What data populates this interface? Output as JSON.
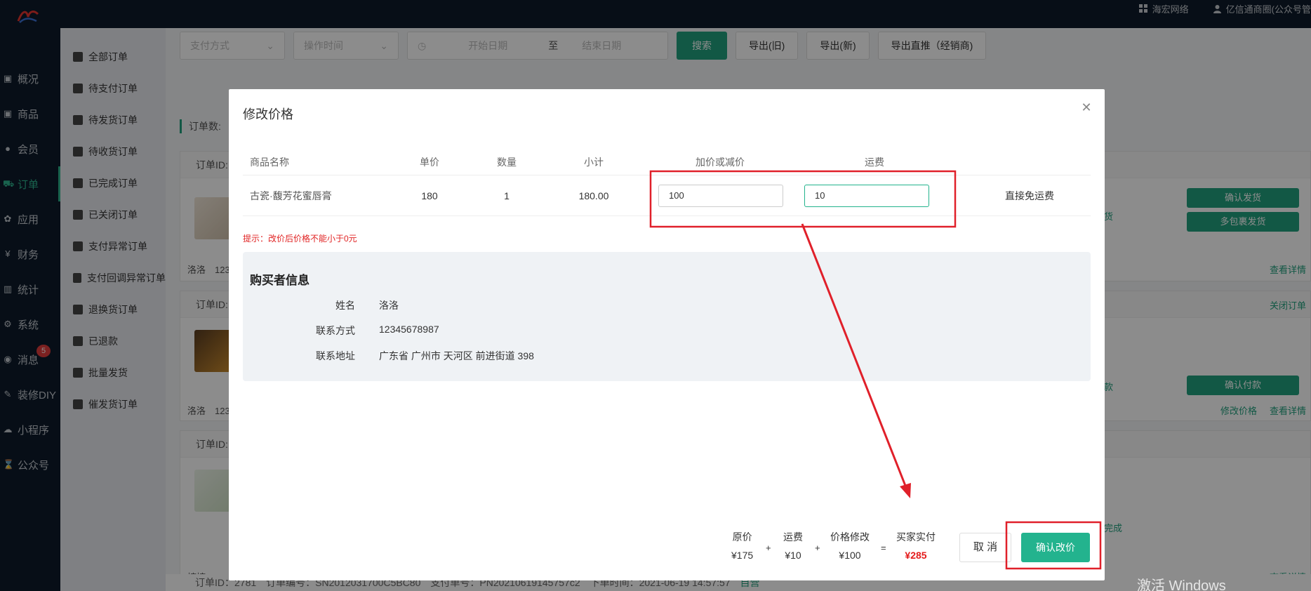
{
  "topbar": {
    "network_label": "海宏网络",
    "account_label": "亿信通商圈(公众号管"
  },
  "sidebar": {
    "items": [
      {
        "label": "概况",
        "icon": "dashboard-icon"
      },
      {
        "label": "商品",
        "icon": "goods-icon"
      },
      {
        "label": "会员",
        "icon": "members-icon"
      },
      {
        "label": "订单",
        "icon": "cart-icon",
        "active": true
      },
      {
        "label": "应用",
        "icon": "apps-icon"
      },
      {
        "label": "财务",
        "icon": "yen-icon"
      },
      {
        "label": "统计",
        "icon": "chart-icon"
      },
      {
        "label": "系统",
        "icon": "gear-icon"
      },
      {
        "label": "消息",
        "icon": "message-icon",
        "badge": "5"
      },
      {
        "label": "装修DIY",
        "icon": "hammer-icon"
      },
      {
        "label": "小程序",
        "icon": "wechat-icon"
      },
      {
        "label": "公众号",
        "icon": "hourglass-icon"
      }
    ]
  },
  "subnav": {
    "items": [
      "全部订单",
      "待支付订单",
      "待发货订单",
      "待收货订单",
      "已完成订单",
      "已关闭订单",
      "支付异常订单",
      "支付回调异常订单",
      "退换货订单",
      "已退款",
      "批量发货",
      "催发货订单"
    ]
  },
  "filters": {
    "payment_placeholder": "支付方式",
    "operation_placeholder": "操作时间",
    "start_date_placeholder": "开始日期",
    "range_sep": "至",
    "end_date_placeholder": "结束日期",
    "search_label": "搜索",
    "export_old_label": "导出(旧)",
    "export_new_label": "导出(新)",
    "export_direct_label": "导出直推（经销商)"
  },
  "orders_bg": {
    "count_label": "订单数:",
    "order_id_label": "订单ID:",
    "buyer1": "洛洛　1234",
    "buyer2": "洛洛　1234",
    "buyer3": "婷婷　1850",
    "status1": "货",
    "status2": "款",
    "status3": "完成",
    "confirm_ship": "确认发货",
    "multi_ship": "多包裹发货",
    "confirm_pay": "确认付款",
    "close_order": "关闭订单",
    "view_detail": "查看详情",
    "modify_price": "修改价格",
    "bottom_row_text": "订单ID：2781　订单编号：SN2012031700C5BC80　支付单号：PN20210619145757c2　下单时间：2021-06-19 14:57:57",
    "bottom_row_tag": "自营"
  },
  "modal": {
    "title": "修改价格",
    "columns": [
      "商品名称",
      "单价",
      "数量",
      "小计",
      "加价或减价",
      "运费"
    ],
    "row": {
      "name": "古瓷·馥芳花蜜唇膏",
      "unit_price": "180",
      "quantity": "1",
      "subtotal": "180.00",
      "adjust_value": "100",
      "shipping_value": "10",
      "free_shipping_link": "直接免运费"
    },
    "hint": "提示：改价后价格不能小于0元",
    "buyer_section": {
      "title": "购买者信息",
      "name_label": "姓名",
      "name_value": "洛洛",
      "contact_label": "联系方式",
      "contact_value": "12345678987",
      "address_label": "联系地址",
      "address_value": "广东省 广州市 天河区 前进街道 398"
    },
    "calc": {
      "orig_label": "原价",
      "orig_value": "¥175",
      "plus1": "+",
      "ship_label": "运费",
      "ship_value": "¥10",
      "plus2": "+",
      "mod_label": "价格修改",
      "mod_value": "¥100",
      "equals": "=",
      "pay_label": "买家实付",
      "pay_value": "¥285"
    },
    "cancel_label": "取 消",
    "confirm_label": "确认改价"
  },
  "watermark": "激活 Windows",
  "colors": {
    "brand": "#23b38e",
    "annotation": "#e0202a",
    "sidebar_bg": "#0d1b2a"
  }
}
